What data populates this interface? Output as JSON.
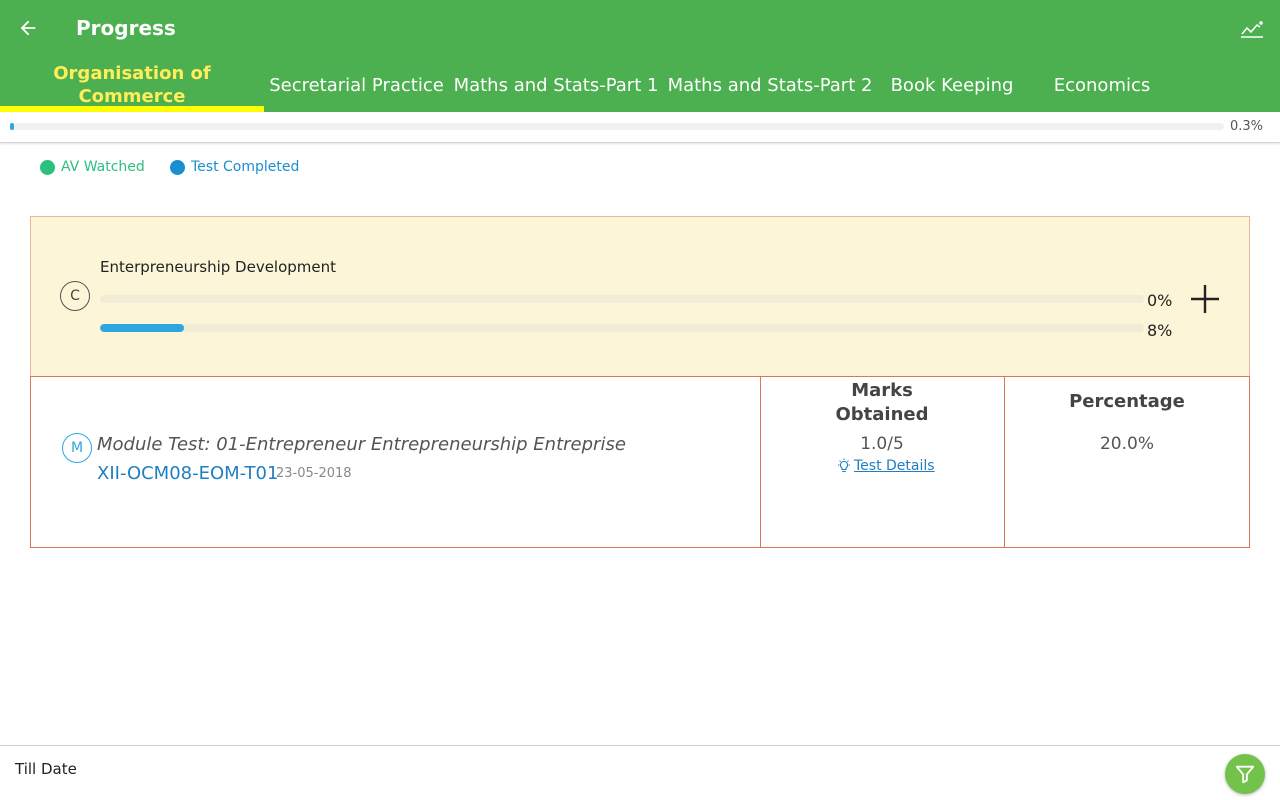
{
  "header": {
    "title": "Progress",
    "back_icon": "arrow-left-icon",
    "chart_icon": "line-chart-icon"
  },
  "tabs": [
    {
      "label": "Organisation of Commerce",
      "active": true
    },
    {
      "label": "Secretarial Practice"
    },
    {
      "label": "Maths and Stats-Part 1"
    },
    {
      "label": "Maths and Stats-Part 2"
    },
    {
      "label": "Book Keeping"
    },
    {
      "label": "Economics"
    }
  ],
  "overall": {
    "percent_label": "0.3%",
    "fraction": 0.003
  },
  "legend": {
    "av_watched": "AV Watched",
    "test_completed": "Test Completed",
    "av_color": "#2dbf7e",
    "test_color": "#1a8fd0"
  },
  "chapter": {
    "badge": "C",
    "title": "Enterpreneurship Development",
    "av_percent_label": "0%",
    "av_fraction": 0.0,
    "test_percent_label": "8%",
    "test_fraction": 0.08,
    "expand_icon": "plus-icon"
  },
  "module": {
    "badge": "M",
    "title": "Module Test: 01-Entrepreneur Entrepreneurship Entreprise",
    "code": "XII-OCM08-EOM-T01",
    "date": "23-05-2018",
    "marks_header": "Marks Obtained",
    "marks_value": "1.0/5",
    "details_label": "Test Details",
    "details_icon": "lightbulb-icon",
    "percentage_header": "Percentage",
    "percentage_value": "20.0%"
  },
  "footer": {
    "label": "Till Date",
    "filter_icon": "filter-icon"
  },
  "colors": {
    "primary": "#4caf50",
    "tab_active": "#ffee58",
    "indicator": "#ffff00",
    "card_bg": "#fdf5d8",
    "card_border": "#d9775a",
    "link": "#1f7fc0",
    "fab": "#72c24b"
  }
}
